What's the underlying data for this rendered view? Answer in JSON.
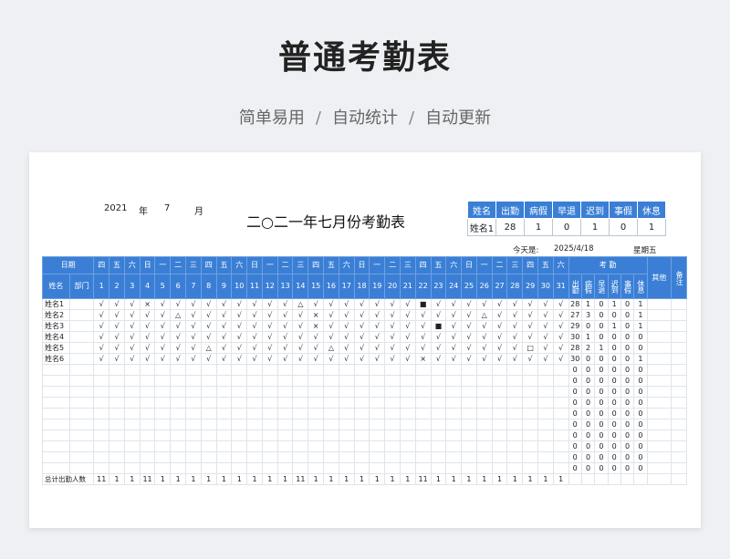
{
  "banner": {
    "title": "普通考勤表",
    "subtitle_parts": [
      "简单易用",
      "自动统计",
      "自动更新"
    ],
    "separator": "/"
  },
  "sheet": {
    "year": "2021",
    "year_unit": "年",
    "month": "7",
    "month_unit": "月",
    "title": "二○二一年七月份考勤表",
    "summary": {
      "headers": [
        "姓名",
        "出勤",
        "病假",
        "早退",
        "迟到",
        "事假",
        "休息"
      ],
      "row": [
        "姓名1",
        "28",
        "1",
        "0",
        "1",
        "0",
        "1"
      ]
    },
    "today_label": "今天是:",
    "today_date": "2025/4/18",
    "today_weekday": "星期五",
    "table": {
      "date_label": "日期",
      "name_label": "姓名",
      "dept_label": "部门",
      "weekdays": [
        "四",
        "五",
        "六",
        "日",
        "一",
        "二",
        "三",
        "四",
        "五",
        "六",
        "日",
        "一",
        "二",
        "三",
        "四",
        "五",
        "六",
        "日",
        "一",
        "二",
        "三",
        "四",
        "五",
        "六",
        "日",
        "一",
        "二",
        "三",
        "四",
        "五",
        "六"
      ],
      "days": [
        "1",
        "2",
        "3",
        "4",
        "5",
        "6",
        "7",
        "8",
        "9",
        "10",
        "11",
        "12",
        "13",
        "14",
        "15",
        "16",
        "17",
        "18",
        "19",
        "20",
        "21",
        "22",
        "23",
        "24",
        "25",
        "26",
        "27",
        "28",
        "29",
        "30",
        "31"
      ],
      "stat_group_label": "考 勤",
      "stat_labels": [
        "出勤",
        "病假",
        "早退",
        "迟到",
        "事假",
        "休息"
      ],
      "other_label": "其他",
      "remark_label": "备注",
      "rows": [
        {
          "name": "姓名1",
          "marks": [
            "√",
            "√",
            "√",
            "×",
            "√",
            "√",
            "√",
            "√",
            "√",
            "√",
            "√",
            "√",
            "√",
            "△",
            "√",
            "√",
            "√",
            "√",
            "√",
            "√",
            "√",
            "■",
            "√",
            "√",
            "√",
            "√",
            "√",
            "√",
            "√",
            "√",
            "√"
          ],
          "stats": [
            "28",
            "1",
            "0",
            "1",
            "0",
            "1"
          ]
        },
        {
          "name": "姓名2",
          "marks": [
            "√",
            "√",
            "√",
            "√",
            "√",
            "△",
            "√",
            "√",
            "√",
            "√",
            "√",
            "√",
            "√",
            "√",
            "×",
            "√",
            "√",
            "√",
            "√",
            "√",
            "√",
            "√",
            "√",
            "√",
            "√",
            "△",
            "√",
            "√",
            "√",
            "√",
            "√"
          ],
          "stats": [
            "27",
            "3",
            "0",
            "0",
            "0",
            "1"
          ]
        },
        {
          "name": "姓名3",
          "marks": [
            "√",
            "√",
            "√",
            "√",
            "√",
            "√",
            "√",
            "√",
            "√",
            "√",
            "√",
            "√",
            "√",
            "√",
            "×",
            "√",
            "√",
            "√",
            "√",
            "√",
            "√",
            "√",
            "■",
            "√",
            "√",
            "√",
            "√",
            "√",
            "√",
            "√",
            "√"
          ],
          "stats": [
            "29",
            "0",
            "0",
            "1",
            "0",
            "1"
          ]
        },
        {
          "name": "姓名4",
          "marks": [
            "√",
            "√",
            "√",
            "√",
            "√",
            "√",
            "√",
            "√",
            "√",
            "√",
            "√",
            "√",
            "√",
            "√",
            "√",
            "√",
            "√",
            "√",
            "√",
            "√",
            "√",
            "√",
            "√",
            "√",
            "√",
            "√",
            "√",
            "√",
            "√",
            "√",
            "√"
          ],
          "stats": [
            "30",
            "1",
            "0",
            "0",
            "0",
            "0"
          ]
        },
        {
          "name": "姓名5",
          "marks": [
            "√",
            "√",
            "√",
            "√",
            "√",
            "√",
            "√",
            "△",
            "√",
            "√",
            "√",
            "√",
            "√",
            "√",
            "√",
            "△",
            "√",
            "√",
            "√",
            "√",
            "√",
            "√",
            "√",
            "√",
            "√",
            "√",
            "√",
            "√",
            "□",
            "√",
            "√"
          ],
          "stats": [
            "28",
            "2",
            "1",
            "0",
            "0",
            "0"
          ]
        },
        {
          "name": "姓名6",
          "marks": [
            "√",
            "√",
            "√",
            "√",
            "√",
            "√",
            "√",
            "√",
            "√",
            "√",
            "√",
            "√",
            "√",
            "√",
            "√",
            "√",
            "√",
            "√",
            "√",
            "√",
            "√",
            "×",
            "√",
            "√",
            "√",
            "√",
            "√",
            "√",
            "√",
            "√",
            "√"
          ],
          "stats": [
            "30",
            "0",
            "0",
            "0",
            "0",
            "1"
          ]
        }
      ],
      "empty_stats": [
        "0",
        "0",
        "0",
        "0",
        "0",
        "0"
      ],
      "empty_row_count": 10,
      "footer_label": "总计出勤人数",
      "footer_values": [
        "11",
        "1",
        "1",
        "11",
        "1",
        "1",
        "1",
        "1",
        "1",
        "1",
        "1",
        "1",
        "1",
        "11",
        "1",
        "1",
        "1",
        "1",
        "1",
        "1",
        "1",
        "11",
        "1",
        "1",
        "1",
        "1",
        "1",
        "1",
        "1",
        "1",
        "1"
      ]
    }
  }
}
